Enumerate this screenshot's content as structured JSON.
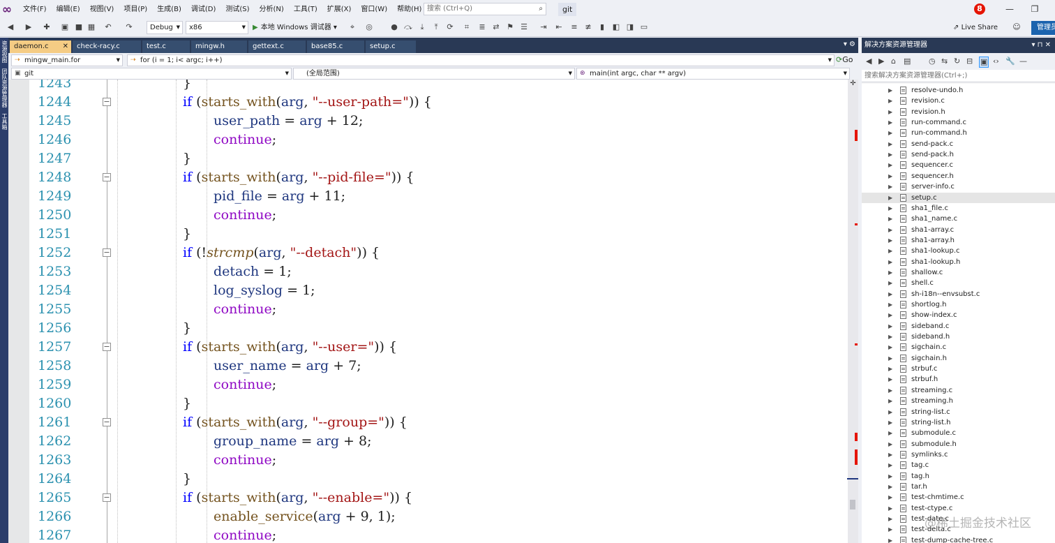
{
  "menu": {
    "items": [
      "文件(F)",
      "编辑(E)",
      "视图(V)",
      "项目(P)",
      "生成(B)",
      "调试(D)",
      "测试(S)",
      "分析(N)",
      "工具(T)",
      "扩展(X)",
      "窗口(W)",
      "帮助(H)"
    ],
    "search_placeholder": "搜索 (Ctrl+Q)",
    "solution_name": "git",
    "notification_count": "8"
  },
  "toolbar": {
    "configuration": "Debug",
    "platform": "x86",
    "run_label": "本地 Windows 调试器",
    "live_share": "Live Share",
    "admin": "管理员"
  },
  "left_strip": [
    "资源视图",
    "团队资源管理器",
    "工具箱"
  ],
  "tabs": [
    {
      "label": "daemon.c",
      "active": true
    },
    {
      "label": "check-racy.c"
    },
    {
      "label": "test.c"
    },
    {
      "label": "mingw.h"
    },
    {
      "label": "gettext.c"
    },
    {
      "label": "base85.c"
    },
    {
      "label": "setup.c"
    }
  ],
  "nav": {
    "file_combo": "mingw_main.for",
    "statement_combo": "for (i = 1; i< argc; i++)",
    "project_combo": "git",
    "scope_combo": "(全局范围)",
    "function_combo": "main(int argc, char ** argv)",
    "go_label": "Go"
  },
  "code": {
    "first_line_number": 1243,
    "lines": [
      {
        "n": "1243",
        "text": "}",
        "indent": 1,
        "fold": false
      },
      {
        "n": "1244",
        "fold": true,
        "indent": 1,
        "tokens": [
          [
            "kw2",
            "if"
          ],
          [
            "op",
            " ("
          ],
          [
            "fn",
            "starts_with"
          ],
          [
            "op",
            "("
          ],
          [
            "var",
            "arg"
          ],
          [
            "op",
            ", "
          ],
          [
            "str",
            "\"--user-path=\""
          ],
          [
            "op",
            ")) {"
          ]
        ]
      },
      {
        "n": "1245",
        "indent": 2,
        "tokens": [
          [
            "var",
            "user_path"
          ],
          [
            "op",
            " = "
          ],
          [
            "var",
            "arg"
          ],
          [
            "op",
            " + 12;"
          ]
        ]
      },
      {
        "n": "1246",
        "indent": 2,
        "tokens": [
          [
            "kw",
            "continue"
          ],
          [
            "op",
            ";"
          ]
        ]
      },
      {
        "n": "1247",
        "indent": 1,
        "tokens": [
          [
            "op",
            "}"
          ]
        ]
      },
      {
        "n": "1248",
        "fold": true,
        "indent": 1,
        "tokens": [
          [
            "kw2",
            "if"
          ],
          [
            "op",
            " ("
          ],
          [
            "fn",
            "starts_with"
          ],
          [
            "op",
            "("
          ],
          [
            "var",
            "arg"
          ],
          [
            "op",
            ", "
          ],
          [
            "str",
            "\"--pid-file=\""
          ],
          [
            "op",
            ")) {"
          ]
        ]
      },
      {
        "n": "1249",
        "indent": 2,
        "tokens": [
          [
            "var",
            "pid_file"
          ],
          [
            "op",
            " = "
          ],
          [
            "var",
            "arg"
          ],
          [
            "op",
            " + 11;"
          ]
        ]
      },
      {
        "n": "1250",
        "indent": 2,
        "tokens": [
          [
            "kw",
            "continue"
          ],
          [
            "op",
            ";"
          ]
        ]
      },
      {
        "n": "1251",
        "indent": 1,
        "tokens": [
          [
            "op",
            "}"
          ]
        ]
      },
      {
        "n": "1252",
        "fold": true,
        "indent": 1,
        "tokens": [
          [
            "kw2",
            "if"
          ],
          [
            "op",
            " (!"
          ],
          [
            "fni",
            "strcmp"
          ],
          [
            "op",
            "("
          ],
          [
            "var",
            "arg"
          ],
          [
            "op",
            ", "
          ],
          [
            "str",
            "\"--detach\""
          ],
          [
            "op",
            ")) {"
          ]
        ]
      },
      {
        "n": "1253",
        "indent": 2,
        "tokens": [
          [
            "var",
            "detach"
          ],
          [
            "op",
            " = 1;"
          ]
        ]
      },
      {
        "n": "1254",
        "indent": 2,
        "tokens": [
          [
            "var",
            "log_syslog"
          ],
          [
            "op",
            " = 1;"
          ]
        ]
      },
      {
        "n": "1255",
        "indent": 2,
        "tokens": [
          [
            "kw",
            "continue"
          ],
          [
            "op",
            ";"
          ]
        ]
      },
      {
        "n": "1256",
        "indent": 1,
        "tokens": [
          [
            "op",
            "}"
          ]
        ]
      },
      {
        "n": "1257",
        "fold": true,
        "indent": 1,
        "tokens": [
          [
            "kw2",
            "if"
          ],
          [
            "op",
            " ("
          ],
          [
            "fn",
            "starts_with"
          ],
          [
            "op",
            "("
          ],
          [
            "var",
            "arg"
          ],
          [
            "op",
            ", "
          ],
          [
            "str",
            "\"--user=\""
          ],
          [
            "op",
            ")) {"
          ]
        ]
      },
      {
        "n": "1258",
        "indent": 2,
        "tokens": [
          [
            "var",
            "user_name"
          ],
          [
            "op",
            " = "
          ],
          [
            "var",
            "arg"
          ],
          [
            "op",
            " + 7;"
          ]
        ]
      },
      {
        "n": "1259",
        "indent": 2,
        "tokens": [
          [
            "kw",
            "continue"
          ],
          [
            "op",
            ";"
          ]
        ]
      },
      {
        "n": "1260",
        "indent": 1,
        "tokens": [
          [
            "op",
            "}"
          ]
        ]
      },
      {
        "n": "1261",
        "fold": true,
        "indent": 1,
        "tokens": [
          [
            "kw2",
            "if"
          ],
          [
            "op",
            " ("
          ],
          [
            "fn",
            "starts_with"
          ],
          [
            "op",
            "("
          ],
          [
            "var",
            "arg"
          ],
          [
            "op",
            ", "
          ],
          [
            "str",
            "\"--group=\""
          ],
          [
            "op",
            ")) {"
          ]
        ]
      },
      {
        "n": "1262",
        "indent": 2,
        "tokens": [
          [
            "var",
            "group_name"
          ],
          [
            "op",
            " = "
          ],
          [
            "var",
            "arg"
          ],
          [
            "op",
            " + 8;"
          ]
        ]
      },
      {
        "n": "1263",
        "indent": 2,
        "tokens": [
          [
            "kw",
            "continue"
          ],
          [
            "op",
            ";"
          ]
        ]
      },
      {
        "n": "1264",
        "indent": 1,
        "tokens": [
          [
            "op",
            "}"
          ]
        ]
      },
      {
        "n": "1265",
        "fold": true,
        "indent": 1,
        "tokens": [
          [
            "kw2",
            "if"
          ],
          [
            "op",
            " ("
          ],
          [
            "fn",
            "starts_with"
          ],
          [
            "op",
            "("
          ],
          [
            "var",
            "arg"
          ],
          [
            "op",
            ", "
          ],
          [
            "str",
            "\"--enable=\""
          ],
          [
            "op",
            ")) {"
          ]
        ]
      },
      {
        "n": "1266",
        "indent": 2,
        "tokens": [
          [
            "fn",
            "enable_service"
          ],
          [
            "op",
            "("
          ],
          [
            "var",
            "arg"
          ],
          [
            "op",
            " + 9, 1);"
          ]
        ]
      },
      {
        "n": "1267",
        "indent": 2,
        "tokens": [
          [
            "kw",
            "continue"
          ],
          [
            "op",
            ";"
          ]
        ]
      }
    ]
  },
  "solution_explorer": {
    "title": "解决方案资源管理器",
    "search_placeholder": "搜索解决方案资源管理器(Ctrl+;)",
    "files": [
      "resolve-undo.h",
      "revision.c",
      "revision.h",
      "run-command.c",
      "run-command.h",
      "send-pack.c",
      "send-pack.h",
      "sequencer.c",
      "sequencer.h",
      "server-info.c",
      "setup.c",
      "sha1_file.c",
      "sha1_name.c",
      "sha1-array.c",
      "sha1-array.h",
      "sha1-lookup.c",
      "sha1-lookup.h",
      "shallow.c",
      "shell.c",
      "sh-i18n--envsubst.c",
      "shortlog.h",
      "show-index.c",
      "sideband.c",
      "sideband.h",
      "sigchain.c",
      "sigchain.h",
      "strbuf.c",
      "strbuf.h",
      "streaming.c",
      "streaming.h",
      "string-list.c",
      "string-list.h",
      "submodule.c",
      "submodule.h",
      "symlinks.c",
      "tag.c",
      "tag.h",
      "tar.h",
      "test-chmtime.c",
      "test-ctype.c",
      "test-date.c",
      "test-delta.c",
      "test-dump-cache-tree.c"
    ],
    "selected": "setup.c"
  },
  "watermark": "@稀土掘金技术社区",
  "colors": {
    "accent": "#293955",
    "active_tab": "#f5cc84",
    "keyword": "#8f08c4",
    "control_keyword": "#0000ff",
    "string": "#a31515",
    "line_number": "#2b91af"
  }
}
